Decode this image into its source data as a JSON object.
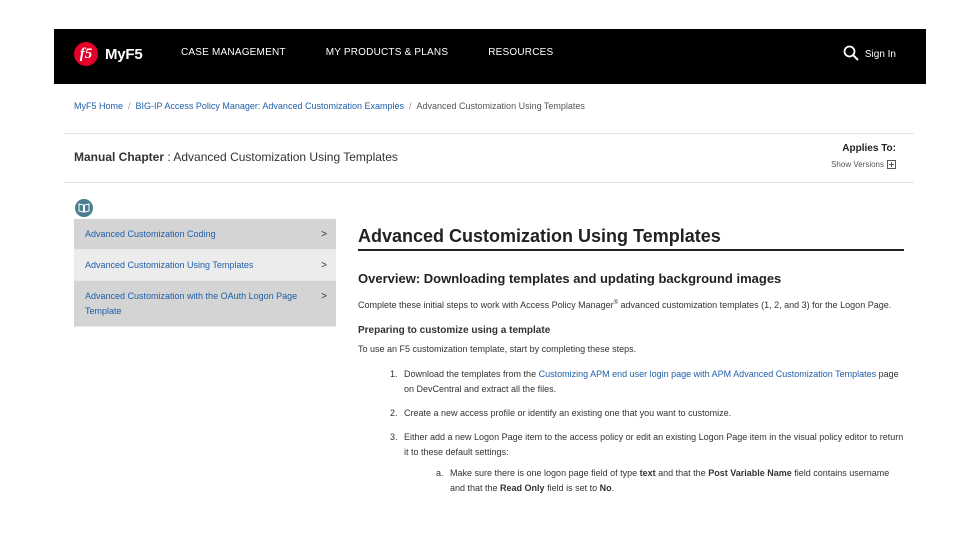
{
  "header": {
    "logo_badge": "f5",
    "logo_text": "MyF5",
    "nav": [
      "CASE MANAGEMENT",
      "MY PRODUCTS & PLANS",
      "RESOURCES"
    ],
    "sign_in": "Sign In"
  },
  "breadcrumb": {
    "items": [
      "MyF5 Home",
      "BIG-IP Access Policy Manager: Advanced Customization Examples"
    ],
    "current": "Advanced Customization Using Templates",
    "separator": "/"
  },
  "chapter": {
    "label": "Manual Chapter",
    "separator": " : ",
    "title": "Advanced Customization Using Templates"
  },
  "applies": {
    "label": "Applies To:",
    "show_versions": "Show Versions"
  },
  "toc": {
    "items": [
      "Advanced Customization Coding",
      "Advanced Customization Using Templates",
      "Advanced Customization with the OAuth Logon Page Template"
    ],
    "chevron": ">"
  },
  "content": {
    "h1": "Advanced Customization Using Templates",
    "h2": "Overview: Downloading templates and updating background images",
    "intro_before": "Complete these initial steps to work with Access Policy Manager",
    "intro_sup": "®",
    "intro_after": " advanced customization templates (1, 2, and 3) for the Logon Page.",
    "h3": "Preparing to customize using a template",
    "p2": "To use an F5 customization template, start by completing these steps.",
    "steps": [
      {
        "num": "1.",
        "before": "Download the templates from the ",
        "link": "Customizing APM end user login page with APM Advanced Customization Templates",
        "after": " page on DevCentral and extract all the files."
      },
      {
        "num": "2.",
        "text": "Create a new access profile or identify an existing one that you want to customize."
      },
      {
        "num": "3.",
        "text": "Either add a new Logon Page item to the access policy or edit an existing Logon Page item in the visual policy editor to return it to these default settings:"
      }
    ],
    "substep": {
      "letter": "a.",
      "t1": "Make sure there is one logon page field of type ",
      "b1": "text",
      "t2": " and that the ",
      "b2": "Post Variable Name",
      "t3": " field contains username and that the ",
      "b3": "Read Only",
      "t4": " field is set to ",
      "b4": "No",
      "t5": "."
    }
  }
}
